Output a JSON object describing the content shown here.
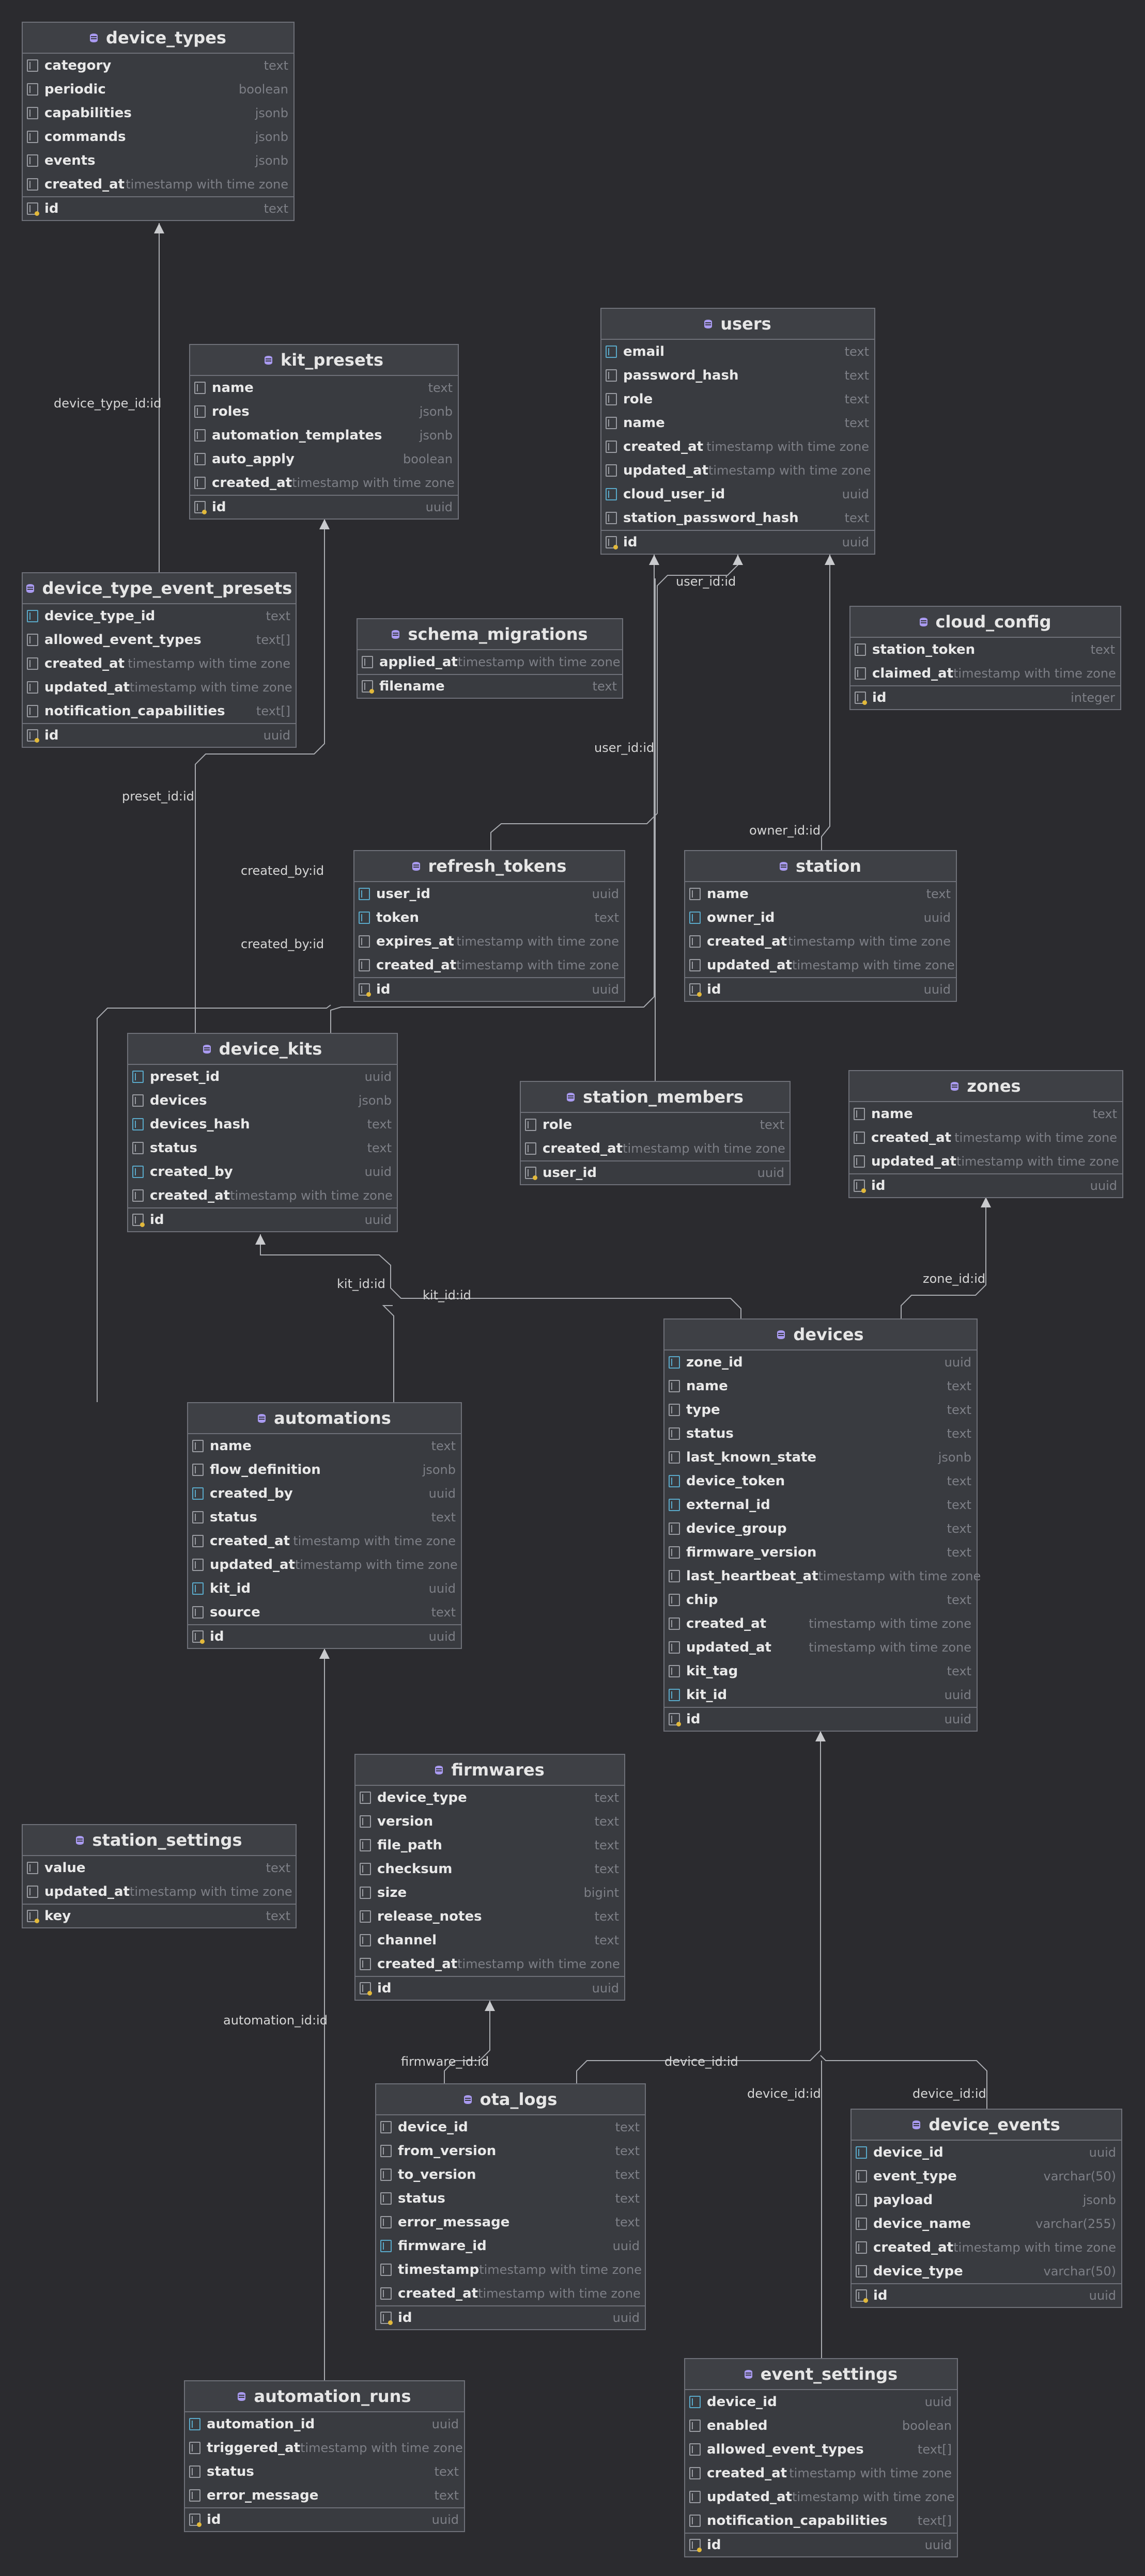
{
  "diagram": {
    "tables": [
      {
        "id": "device_types",
        "name": "device_types",
        "columns": [
          {
            "name": "category",
            "type": "text",
            "key": "col"
          },
          {
            "name": "periodic",
            "type": "boolean",
            "key": "col"
          },
          {
            "name": "capabilities",
            "type": "jsonb",
            "key": "col"
          },
          {
            "name": "commands",
            "type": "jsonb",
            "key": "col"
          },
          {
            "name": "events",
            "type": "jsonb",
            "key": "col"
          },
          {
            "name": "created_at",
            "type": "timestamp with time zone",
            "key": "col"
          },
          {
            "name": "id",
            "type": "text",
            "key": "pk"
          }
        ]
      },
      {
        "id": "kit_presets",
        "name": "kit_presets",
        "columns": [
          {
            "name": "name",
            "type": "text",
            "key": "col"
          },
          {
            "name": "roles",
            "type": "jsonb",
            "key": "col"
          },
          {
            "name": "automation_templates",
            "type": "jsonb",
            "key": "col"
          },
          {
            "name": "auto_apply",
            "type": "boolean",
            "key": "col"
          },
          {
            "name": "created_at",
            "type": "timestamp with time zone",
            "key": "col"
          },
          {
            "name": "id",
            "type": "uuid",
            "key": "pk"
          }
        ]
      },
      {
        "id": "users",
        "name": "users",
        "columns": [
          {
            "name": "email",
            "type": "text",
            "key": "idx"
          },
          {
            "name": "password_hash",
            "type": "text",
            "key": "col"
          },
          {
            "name": "role",
            "type": "text",
            "key": "col"
          },
          {
            "name": "name",
            "type": "text",
            "key": "col"
          },
          {
            "name": "created_at",
            "type": "timestamp with time zone",
            "key": "col"
          },
          {
            "name": "updated_at",
            "type": "timestamp with time zone",
            "key": "col"
          },
          {
            "name": "cloud_user_id",
            "type": "uuid",
            "key": "idx"
          },
          {
            "name": "station_password_hash",
            "type": "text",
            "key": "col"
          },
          {
            "name": "id",
            "type": "uuid",
            "key": "pk"
          }
        ]
      },
      {
        "id": "device_type_event_presets",
        "name": "device_type_event_presets",
        "columns": [
          {
            "name": "device_type_id",
            "type": "text",
            "key": "fk"
          },
          {
            "name": "allowed_event_types",
            "type": "text[]",
            "key": "col"
          },
          {
            "name": "created_at",
            "type": "timestamp with time zone",
            "key": "col"
          },
          {
            "name": "updated_at",
            "type": "timestamp with time zone",
            "key": "col"
          },
          {
            "name": "notification_capabilities",
            "type": "text[]",
            "key": "col"
          },
          {
            "name": "id",
            "type": "uuid",
            "key": "pk"
          }
        ]
      },
      {
        "id": "schema_migrations",
        "name": "schema_migrations",
        "columns": [
          {
            "name": "applied_at",
            "type": "timestamp with time zone",
            "key": "col"
          },
          {
            "name": "filename",
            "type": "text",
            "key": "pk"
          }
        ]
      },
      {
        "id": "cloud_config",
        "name": "cloud_config",
        "columns": [
          {
            "name": "station_token",
            "type": "text",
            "key": "col"
          },
          {
            "name": "claimed_at",
            "type": "timestamp with time zone",
            "key": "col"
          },
          {
            "name": "id",
            "type": "integer",
            "key": "pk"
          }
        ]
      },
      {
        "id": "refresh_tokens",
        "name": "refresh_tokens",
        "columns": [
          {
            "name": "user_id",
            "type": "uuid",
            "key": "fk"
          },
          {
            "name": "token",
            "type": "text",
            "key": "idx"
          },
          {
            "name": "expires_at",
            "type": "timestamp with time zone",
            "key": "col"
          },
          {
            "name": "created_at",
            "type": "timestamp with time zone",
            "key": "col"
          },
          {
            "name": "id",
            "type": "uuid",
            "key": "pk"
          }
        ]
      },
      {
        "id": "station",
        "name": "station",
        "columns": [
          {
            "name": "name",
            "type": "text",
            "key": "col"
          },
          {
            "name": "owner_id",
            "type": "uuid",
            "key": "fk"
          },
          {
            "name": "created_at",
            "type": "timestamp with time zone",
            "key": "col"
          },
          {
            "name": "updated_at",
            "type": "timestamp with time zone",
            "key": "col"
          },
          {
            "name": "id",
            "type": "uuid",
            "key": "pk"
          }
        ]
      },
      {
        "id": "device_kits",
        "name": "device_kits",
        "columns": [
          {
            "name": "preset_id",
            "type": "uuid",
            "key": "fk"
          },
          {
            "name": "devices",
            "type": "jsonb",
            "key": "col"
          },
          {
            "name": "devices_hash",
            "type": "text",
            "key": "idx"
          },
          {
            "name": "status",
            "type": "text",
            "key": "col"
          },
          {
            "name": "created_by",
            "type": "uuid",
            "key": "fk"
          },
          {
            "name": "created_at",
            "type": "timestamp with time zone",
            "key": "col"
          },
          {
            "name": "id",
            "type": "uuid",
            "key": "pk"
          }
        ]
      },
      {
        "id": "station_members",
        "name": "station_members",
        "columns": [
          {
            "name": "role",
            "type": "text",
            "key": "col"
          },
          {
            "name": "created_at",
            "type": "timestamp with time zone",
            "key": "col"
          },
          {
            "name": "user_id",
            "type": "uuid",
            "key": "pk"
          }
        ]
      },
      {
        "id": "zones",
        "name": "zones",
        "columns": [
          {
            "name": "name",
            "type": "text",
            "key": "col"
          },
          {
            "name": "created_at",
            "type": "timestamp with time zone",
            "key": "col"
          },
          {
            "name": "updated_at",
            "type": "timestamp with time zone",
            "key": "col"
          },
          {
            "name": "id",
            "type": "uuid",
            "key": "pk"
          }
        ]
      },
      {
        "id": "devices",
        "name": "devices",
        "columns": [
          {
            "name": "zone_id",
            "type": "uuid",
            "key": "fk"
          },
          {
            "name": "name",
            "type": "text",
            "key": "col"
          },
          {
            "name": "type",
            "type": "text",
            "key": "col"
          },
          {
            "name": "status",
            "type": "text",
            "key": "col"
          },
          {
            "name": "last_known_state",
            "type": "jsonb",
            "key": "col"
          },
          {
            "name": "device_token",
            "type": "text",
            "key": "idx"
          },
          {
            "name": "external_id",
            "type": "text",
            "key": "idx"
          },
          {
            "name": "device_group",
            "type": "text",
            "key": "col"
          },
          {
            "name": "firmware_version",
            "type": "text",
            "key": "col"
          },
          {
            "name": "last_heartbeat_at",
            "type": "timestamp with time zone",
            "key": "col"
          },
          {
            "name": "chip",
            "type": "text",
            "key": "col"
          },
          {
            "name": "created_at",
            "type": "timestamp with time zone",
            "key": "col"
          },
          {
            "name": "updated_at",
            "type": "timestamp with time zone",
            "key": "col"
          },
          {
            "name": "kit_tag",
            "type": "text",
            "key": "col"
          },
          {
            "name": "kit_id",
            "type": "uuid",
            "key": "fk"
          },
          {
            "name": "id",
            "type": "uuid",
            "key": "pk"
          }
        ]
      },
      {
        "id": "automations",
        "name": "automations",
        "columns": [
          {
            "name": "name",
            "type": "text",
            "key": "col"
          },
          {
            "name": "flow_definition",
            "type": "jsonb",
            "key": "col"
          },
          {
            "name": "created_by",
            "type": "uuid",
            "key": "fk"
          },
          {
            "name": "status",
            "type": "text",
            "key": "col"
          },
          {
            "name": "created_at",
            "type": "timestamp with time zone",
            "key": "col"
          },
          {
            "name": "updated_at",
            "type": "timestamp with time zone",
            "key": "col"
          },
          {
            "name": "kit_id",
            "type": "uuid",
            "key": "fk"
          },
          {
            "name": "source",
            "type": "text",
            "key": "col"
          },
          {
            "name": "id",
            "type": "uuid",
            "key": "pk"
          }
        ]
      },
      {
        "id": "firmwares",
        "name": "firmwares",
        "columns": [
          {
            "name": "device_type",
            "type": "text",
            "key": "col"
          },
          {
            "name": "version",
            "type": "text",
            "key": "col"
          },
          {
            "name": "file_path",
            "type": "text",
            "key": "col"
          },
          {
            "name": "checksum",
            "type": "text",
            "key": "col"
          },
          {
            "name": "size",
            "type": "bigint",
            "key": "col"
          },
          {
            "name": "release_notes",
            "type": "text",
            "key": "col"
          },
          {
            "name": "channel",
            "type": "text",
            "key": "col"
          },
          {
            "name": "created_at",
            "type": "timestamp with time zone",
            "key": "col"
          },
          {
            "name": "id",
            "type": "uuid",
            "key": "pk"
          }
        ]
      },
      {
        "id": "station_settings",
        "name": "station_settings",
        "columns": [
          {
            "name": "value",
            "type": "text",
            "key": "col"
          },
          {
            "name": "updated_at",
            "type": "timestamp with time zone",
            "key": "col"
          },
          {
            "name": "key",
            "type": "text",
            "key": "pk"
          }
        ]
      },
      {
        "id": "ota_logs",
        "name": "ota_logs",
        "columns": [
          {
            "name": "device_id",
            "type": "text",
            "key": "col"
          },
          {
            "name": "from_version",
            "type": "text",
            "key": "col"
          },
          {
            "name": "to_version",
            "type": "text",
            "key": "col"
          },
          {
            "name": "status",
            "type": "text",
            "key": "col"
          },
          {
            "name": "error_message",
            "type": "text",
            "key": "col"
          },
          {
            "name": "firmware_id",
            "type": "uuid",
            "key": "fk"
          },
          {
            "name": "timestamp",
            "type": "timestamp with time zone",
            "key": "col"
          },
          {
            "name": "created_at",
            "type": "timestamp with time zone",
            "key": "col"
          },
          {
            "name": "id",
            "type": "uuid",
            "key": "pk"
          }
        ]
      },
      {
        "id": "device_events",
        "name": "device_events",
        "columns": [
          {
            "name": "device_id",
            "type": "uuid",
            "key": "fk"
          },
          {
            "name": "event_type",
            "type": "varchar(50)",
            "key": "col"
          },
          {
            "name": "payload",
            "type": "jsonb",
            "key": "col"
          },
          {
            "name": "device_name",
            "type": "varchar(255)",
            "key": "col"
          },
          {
            "name": "created_at",
            "type": "timestamp with time zone",
            "key": "col"
          },
          {
            "name": "device_type",
            "type": "varchar(50)",
            "key": "col"
          },
          {
            "name": "id",
            "type": "uuid",
            "key": "pk"
          }
        ]
      },
      {
        "id": "automation_runs",
        "name": "automation_runs",
        "columns": [
          {
            "name": "automation_id",
            "type": "uuid",
            "key": "fk"
          },
          {
            "name": "triggered_at",
            "type": "timestamp with time zone",
            "key": "col"
          },
          {
            "name": "status",
            "type": "text",
            "key": "col"
          },
          {
            "name": "error_message",
            "type": "text",
            "key": "col"
          },
          {
            "name": "id",
            "type": "uuid",
            "key": "pk"
          }
        ]
      },
      {
        "id": "event_settings",
        "name": "event_settings",
        "columns": [
          {
            "name": "device_id",
            "type": "uuid",
            "key": "fk"
          },
          {
            "name": "enabled",
            "type": "boolean",
            "key": "col"
          },
          {
            "name": "allowed_event_types",
            "type": "text[]",
            "key": "col"
          },
          {
            "name": "created_at",
            "type": "timestamp with time zone",
            "key": "col"
          },
          {
            "name": "updated_at",
            "type": "timestamp with time zone",
            "key": "col"
          },
          {
            "name": "notification_capabilities",
            "type": "text[]",
            "key": "col"
          },
          {
            "name": "id",
            "type": "uuid",
            "key": "pk"
          }
        ]
      }
    ],
    "relations": [
      {
        "id": "r1",
        "label": "device_type_id:id",
        "from": "device_type_event_presets",
        "to": "device_types"
      },
      {
        "id": "r2",
        "label": "preset_id:id",
        "from": "device_kits",
        "to": "kit_presets"
      },
      {
        "id": "r3",
        "label": "created_by:id",
        "from": "device_kits",
        "to": "users"
      },
      {
        "id": "r4",
        "label": "created_by:id",
        "from": "automations",
        "to": "users"
      },
      {
        "id": "r5",
        "label": "user_id:id",
        "from": "refresh_tokens",
        "to": "users"
      },
      {
        "id": "r6",
        "label": "user_id:id",
        "from": "station_members",
        "to": "users"
      },
      {
        "id": "r7",
        "label": "owner_id:id",
        "from": "station",
        "to": "users"
      },
      {
        "id": "r8",
        "label": "kit_id:id",
        "from": "automations",
        "to": "device_kits"
      },
      {
        "id": "r9",
        "label": "kit_id:id",
        "from": "devices",
        "to": "device_kits"
      },
      {
        "id": "r10",
        "label": "zone_id:id",
        "from": "devices",
        "to": "zones"
      },
      {
        "id": "r11",
        "label": "automation_id:id",
        "from": "automation_runs",
        "to": "automations"
      },
      {
        "id": "r12",
        "label": "firmware_id:id",
        "from": "ota_logs",
        "to": "firmwares"
      },
      {
        "id": "r13",
        "label": "device_id:id",
        "from": "ota_logs",
        "to": "devices"
      },
      {
        "id": "r14",
        "label": "device_id:id",
        "from": "event_settings",
        "to": "devices"
      },
      {
        "id": "r15",
        "label": "device_id:id",
        "from": "device_events",
        "to": "devices"
      }
    ]
  }
}
